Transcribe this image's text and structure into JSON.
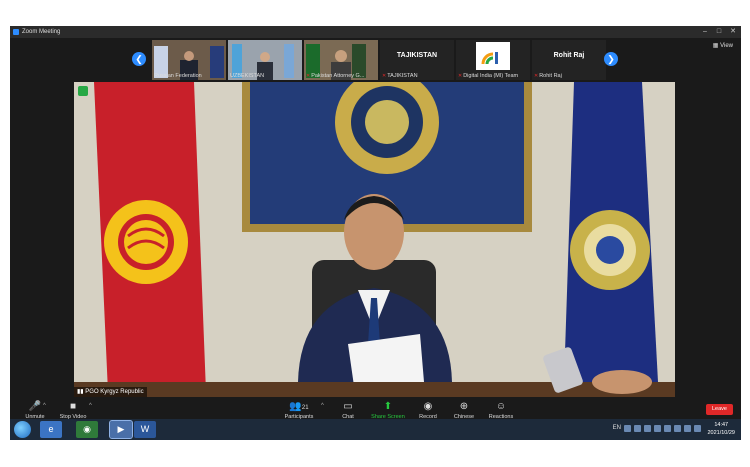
{
  "window": {
    "title": "Zoom Meeting",
    "view_label": "View"
  },
  "thumbnails": [
    {
      "name": "Russian Federation",
      "muted": false,
      "video": true
    },
    {
      "name": "UZBEKISTAN",
      "muted": false,
      "video": true
    },
    {
      "name": "Pakistan Attorney G...",
      "muted": true,
      "video": true
    },
    {
      "name": "TAJIKISTAN",
      "big": "TAJIKISTAN",
      "muted": true,
      "video": false
    },
    {
      "name": "Digital India (MI) Team",
      "muted": true,
      "video": true
    },
    {
      "name": "Rohit Raj",
      "big": "Rohit Raj",
      "muted": true,
      "video": false
    }
  ],
  "speaker": {
    "name": "PGO Kyrgyz Republic"
  },
  "toolbar": {
    "unmute": "Unmute",
    "stop_video": "Stop Video",
    "participants": "Participants",
    "participants_count": "21",
    "chat": "Chat",
    "share_screen": "Share Screen",
    "record": "Record",
    "language": "Chinese",
    "reactions": "Reactions",
    "leave": "Leave"
  },
  "taskbar": {
    "language": "EN",
    "time": "14:47",
    "date": "2021/10/29"
  },
  "colors": {
    "accent": "#2d8cff",
    "leave": "#e02828",
    "share": "#27c93f",
    "taskbar": "#1d2a3a"
  }
}
